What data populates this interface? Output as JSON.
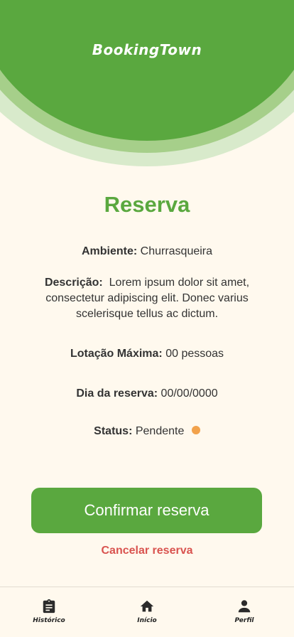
{
  "app": {
    "brand": "BookingTown"
  },
  "page": {
    "title": "Reserva"
  },
  "details": {
    "ambiente_label": "Ambiente:",
    "ambiente_value": "Churrasqueira",
    "descricao_label": "Descrição:",
    "descricao_value": "Lorem ipsum dolor sit amet, consectetur adipiscing elit. Donec varius scelerisque tellus ac dictum.",
    "lotacao_label": "Lotação Máxima:",
    "lotacao_value": "00 pessoas",
    "dia_label": "Dia da reserva:",
    "dia_value": "00/00/0000",
    "status_label": "Status:",
    "status_value": "Pendente",
    "status_color": "#F2A24B"
  },
  "actions": {
    "confirm_label": "Confirmar reserva",
    "cancel_label": "Cancelar reserva"
  },
  "nav": {
    "items": [
      {
        "label": "Histórico",
        "icon": "clipboard-icon"
      },
      {
        "label": "Início",
        "icon": "home-icon"
      },
      {
        "label": "Perfil",
        "icon": "person-icon"
      }
    ]
  },
  "colors": {
    "brand": "#5AA83F",
    "background": "#FFF9EE",
    "cancel": "#D9534F"
  }
}
